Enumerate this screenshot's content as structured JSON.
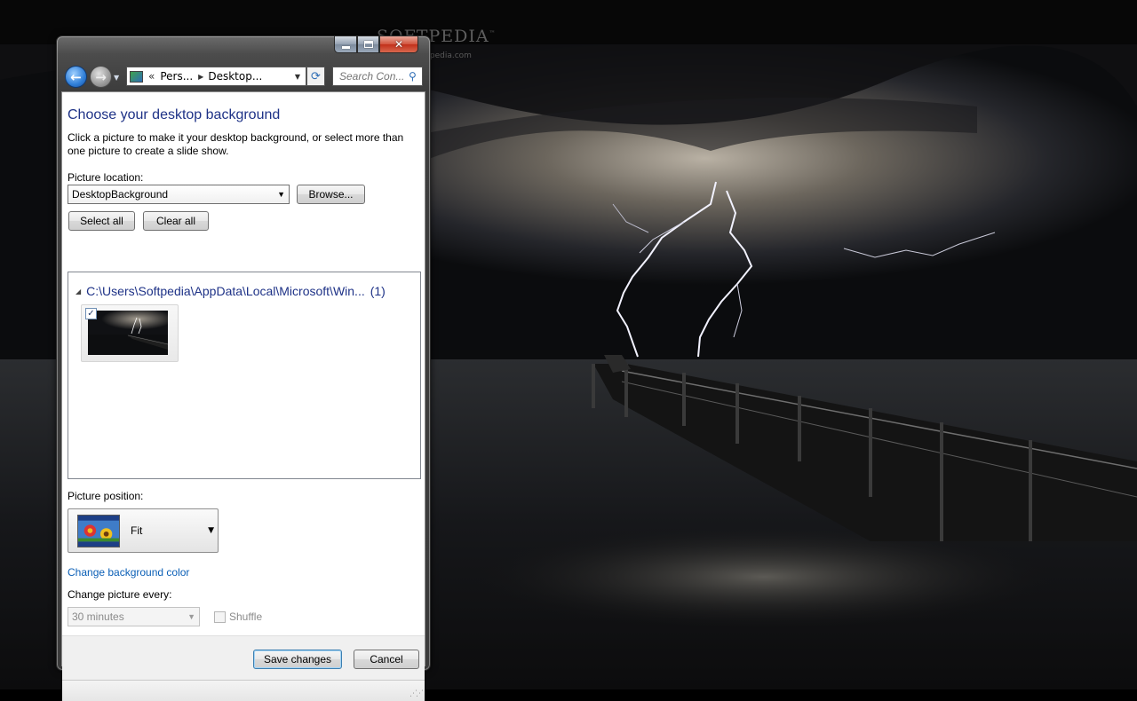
{
  "watermark": {
    "brand": "SOFTPEDIA",
    "tm": "™",
    "url": "www.softpedia.com"
  },
  "window": {
    "caption_icons": [
      "minimize-icon",
      "maximize-icon",
      "close-icon"
    ]
  },
  "nav": {
    "address_chevron": "«",
    "breadcrumb": [
      "Pers...",
      "Desktop..."
    ],
    "search_placeholder": "Search Con..."
  },
  "main": {
    "title": "Choose your desktop background",
    "description": "Click a picture to make it your desktop background, or select more than one picture to create a slide show.",
    "picture_location_label": "Picture location:",
    "picture_location_value": "DesktopBackground",
    "browse_label": "Browse...",
    "select_all_label": "Select all",
    "clear_all_label": "Clear all",
    "gallery": {
      "group_path": "C:\\Users\\Softpedia\\AppData\\Local\\Microsoft\\Win...",
      "group_count": "(1)",
      "items": [
        {
          "checked": true,
          "check_glyph": "✓"
        }
      ]
    },
    "picture_position_label": "Picture position:",
    "picture_position_value": "Fit",
    "change_bg_color_link": "Change background color",
    "change_every_label": "Change picture every:",
    "change_every_value": "30 minutes",
    "shuffle_label": "Shuffle",
    "save_label": "Save changes",
    "cancel_label": "Cancel"
  },
  "colors": {
    "title_blue": "#1e3287",
    "link_blue": "#0b5fb6",
    "close_red": "#c2301a"
  }
}
